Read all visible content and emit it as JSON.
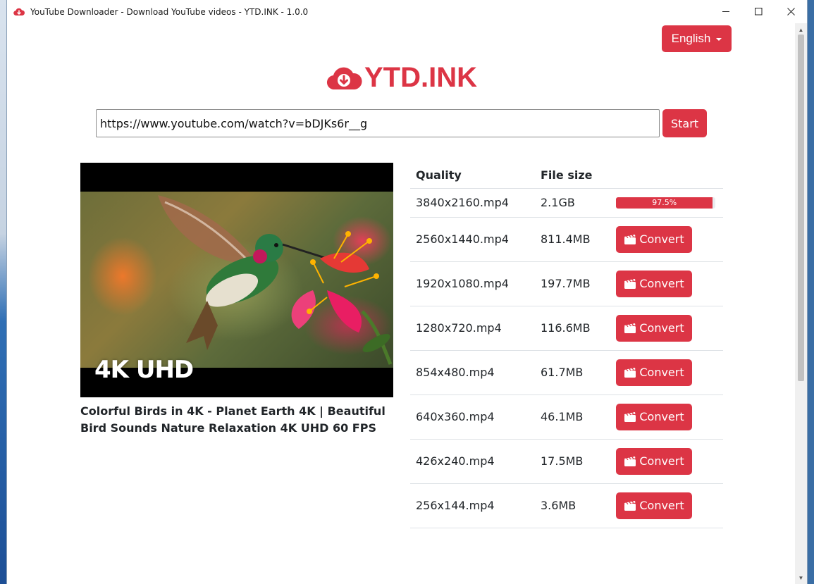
{
  "window": {
    "title": "YouTube Downloader - Download YouTube videos - YTD.INK - 1.0.0",
    "controls": [
      "minimize",
      "maximize",
      "close"
    ]
  },
  "header": {
    "language_label": "English",
    "logo_text": "YTD.INK"
  },
  "search": {
    "url_value": "https://www.youtube.com/watch?v=bDJKs6r__g",
    "start_label": "Start"
  },
  "video": {
    "thumbnail_badge": "4K UHD",
    "title": "Colorful Birds in 4K - Planet Earth 4K | Beautiful Bird Sounds Nature Relaxation 4K UHD 60 FPS"
  },
  "formats": {
    "columns": [
      "Quality",
      "File size"
    ],
    "rows": [
      {
        "quality": "3840x2160.mp4",
        "size": "2.1GB",
        "progress": 97.5,
        "progress_label": "97.5%"
      },
      {
        "quality": "2560x1440.mp4",
        "size": "811.4MB",
        "action": "Convert"
      },
      {
        "quality": "1920x1080.mp4",
        "size": "197.7MB",
        "action": "Convert"
      },
      {
        "quality": "1280x720.mp4",
        "size": "116.6MB",
        "action": "Convert"
      },
      {
        "quality": "854x480.mp4",
        "size": "61.7MB",
        "action": "Convert"
      },
      {
        "quality": "640x360.mp4",
        "size": "46.1MB",
        "action": "Convert"
      },
      {
        "quality": "426x240.mp4",
        "size": "17.5MB",
        "action": "Convert"
      },
      {
        "quality": "256x144.mp4",
        "size": "3.6MB",
        "action": "Convert"
      }
    ]
  },
  "colors": {
    "accent": "#dc3545"
  },
  "icons": {
    "app": "cloud-download-icon",
    "convert": "film-icon"
  }
}
